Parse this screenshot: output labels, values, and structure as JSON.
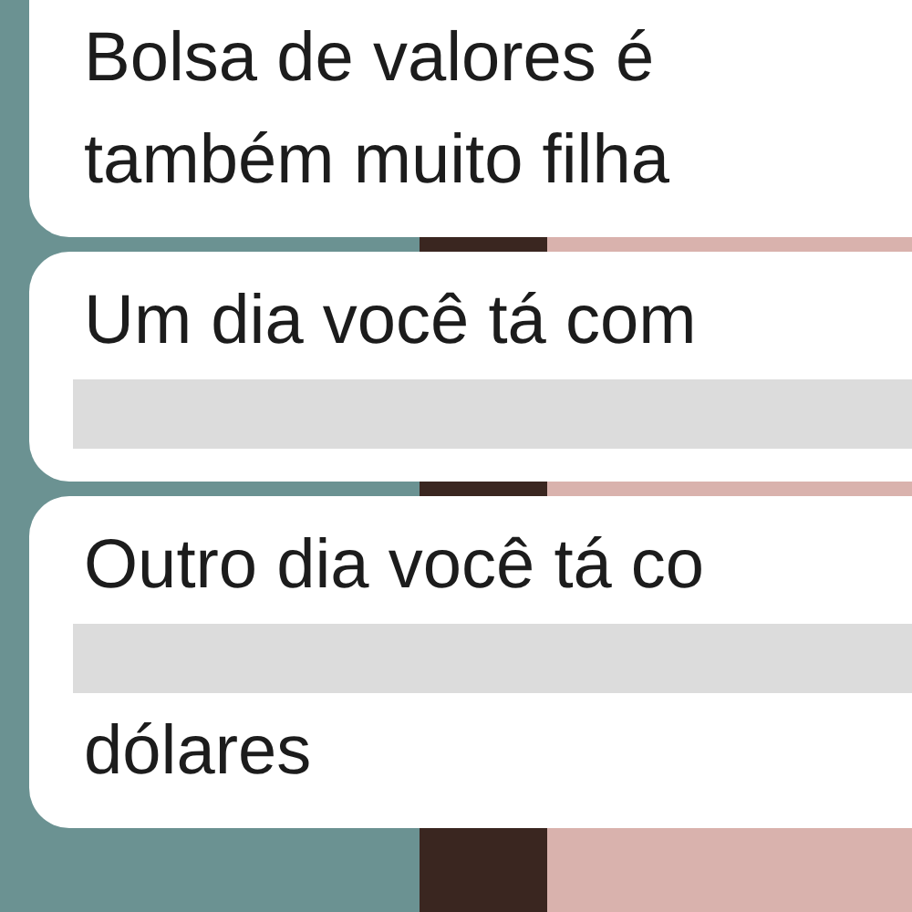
{
  "messages": [
    {
      "lines": [
        {
          "kind": "text",
          "text": "Bolsa de valores é"
        },
        {
          "kind": "text",
          "text": "também muito filha"
        }
      ]
    },
    {
      "lines": [
        {
          "kind": "text",
          "text": "Um dia você tá com"
        },
        {
          "kind": "redacted"
        }
      ]
    },
    {
      "lines": [
        {
          "kind": "text",
          "text": "Outro dia você tá co"
        },
        {
          "kind": "redacted"
        },
        {
          "kind": "text",
          "text": "dólares"
        }
      ]
    }
  ]
}
